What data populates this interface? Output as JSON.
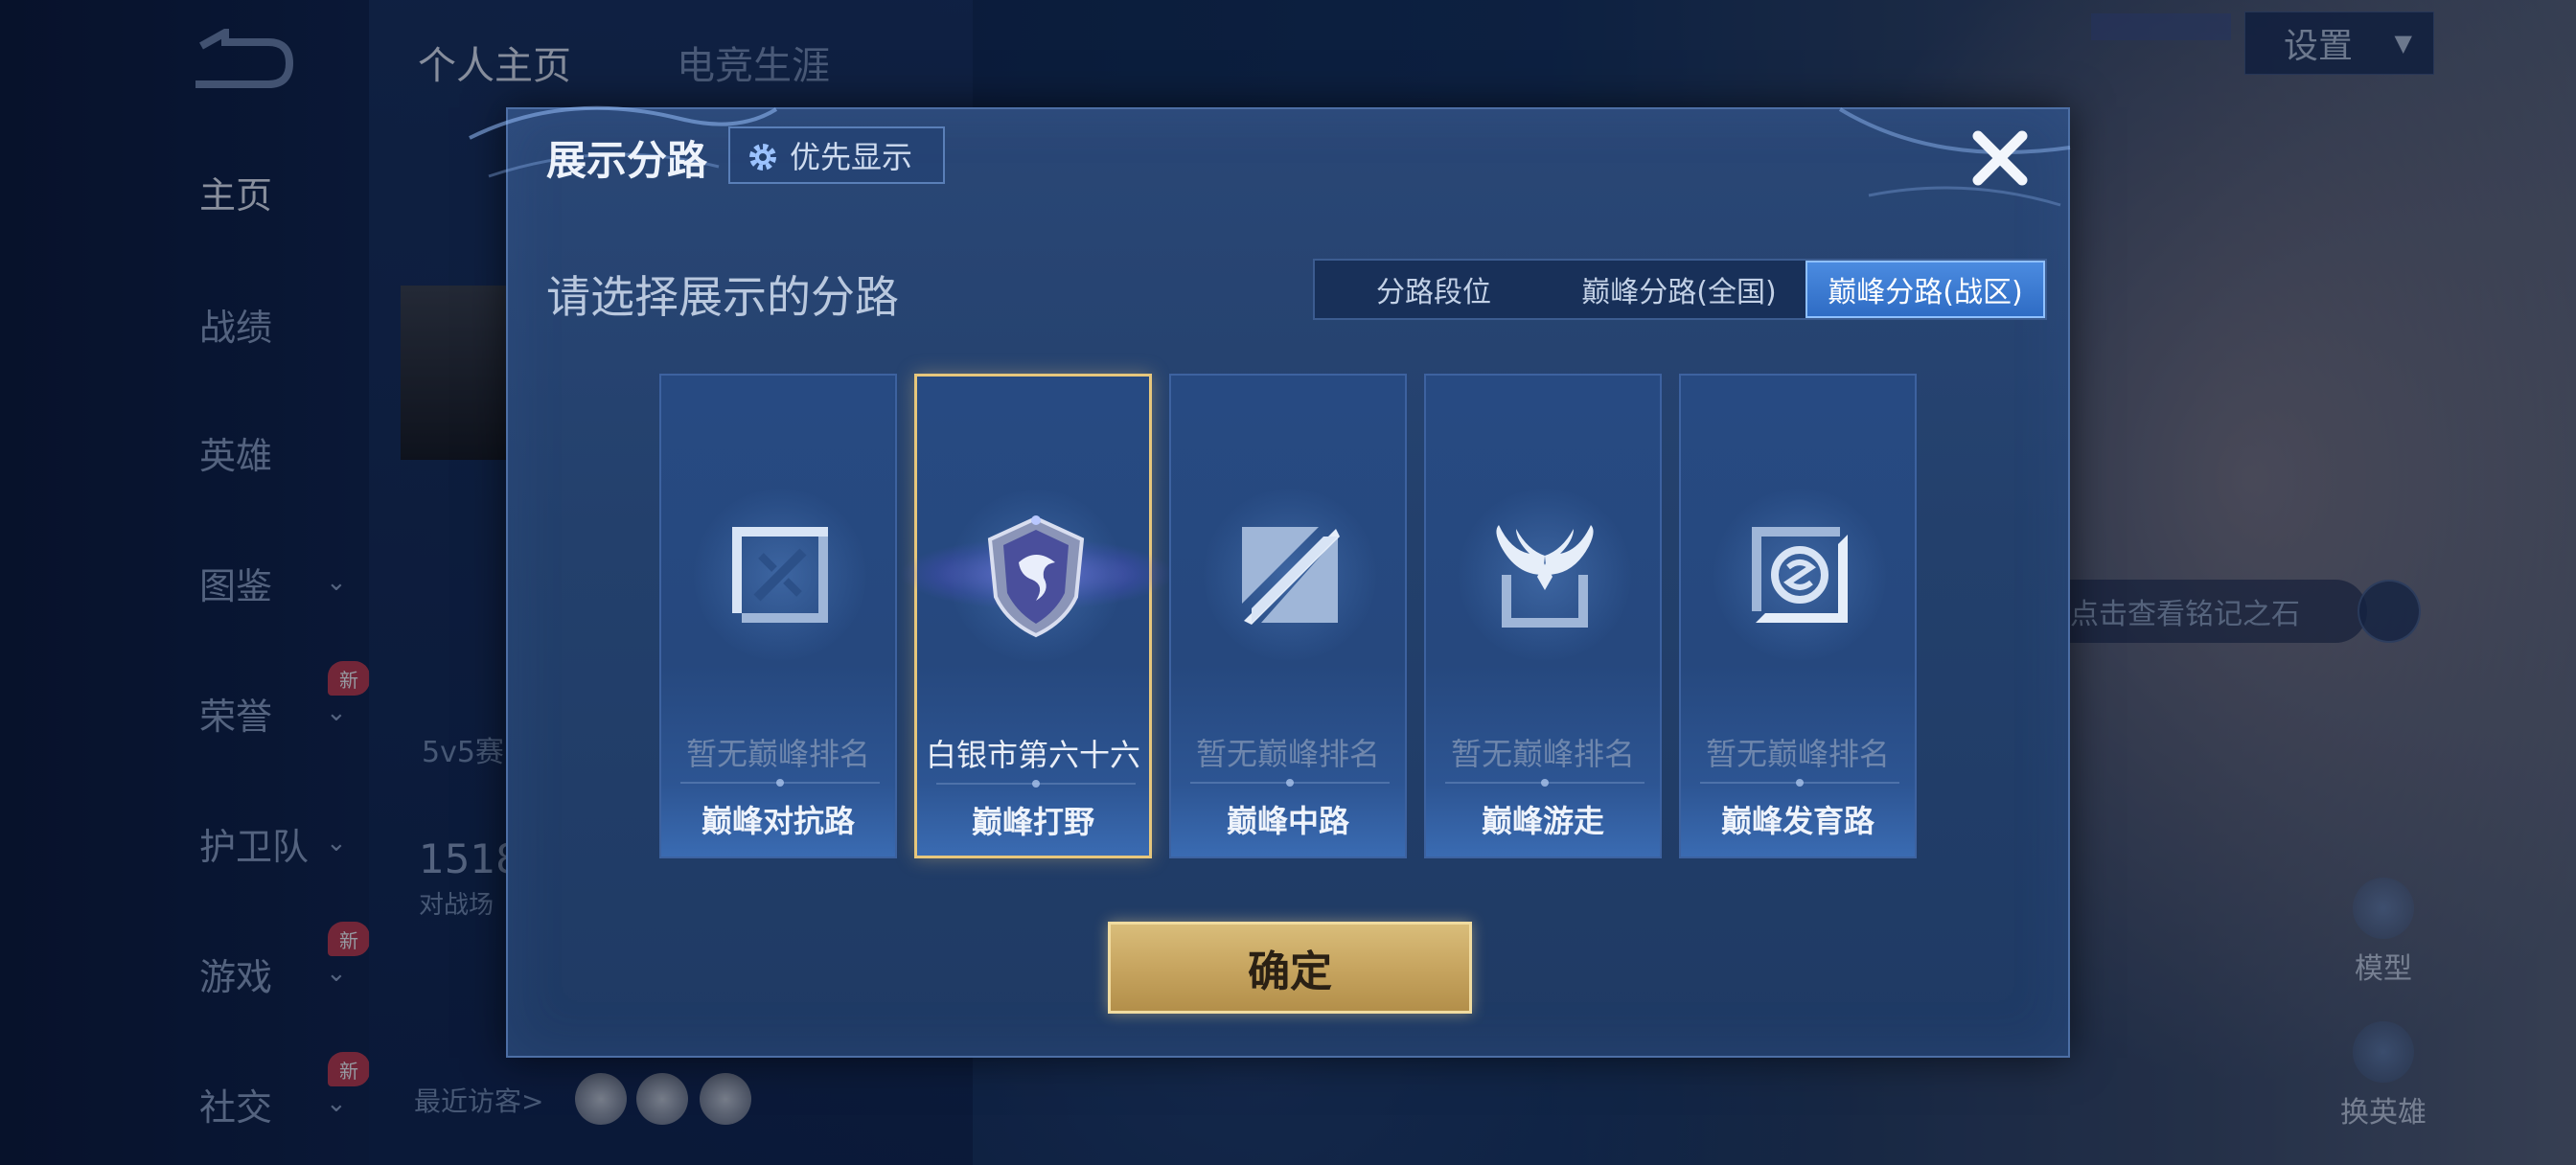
{
  "top_tabs": [
    "个人主页",
    "电竞生涯"
  ],
  "left_nav": [
    {
      "label": "主页",
      "active": true,
      "chevron": false,
      "badge": ""
    },
    {
      "label": "战绩",
      "active": false,
      "chevron": false,
      "badge": ""
    },
    {
      "label": "英雄",
      "active": false,
      "chevron": false,
      "badge": ""
    },
    {
      "label": "图鉴",
      "active": false,
      "chevron": true,
      "badge": ""
    },
    {
      "label": "荣誉",
      "active": false,
      "chevron": true,
      "badge": "新"
    },
    {
      "label": "护卫队",
      "active": false,
      "chevron": true,
      "badge": ""
    },
    {
      "label": "游戏",
      "active": false,
      "chevron": true,
      "badge": "新"
    },
    {
      "label": "社交",
      "active": false,
      "chevron": true,
      "badge": "新"
    }
  ],
  "settings": {
    "label": "设置"
  },
  "background": {
    "mid_text_1": "5v5赛",
    "mid_text_2": "1518",
    "mid_text_3": "对战场",
    "recent_visitors": "最近访客>",
    "rune_hint": "点击查看铭记之石",
    "model_btn": "模型",
    "change_hero_btn": "换英雄"
  },
  "dialog": {
    "title": "展示分路",
    "priority_label": "优先显示",
    "subtitle": "请选择展示的分路",
    "segments": [
      {
        "label": "分路段位",
        "active": false
      },
      {
        "label": "巅峰分路(全国)",
        "active": false
      },
      {
        "label": "巅峰分路(战区)",
        "active": true
      }
    ],
    "lanes": [
      {
        "name": "巅峰对抗路",
        "rank": "暂无巅峰排名",
        "selected": false,
        "icon": "clash-lane-icon"
      },
      {
        "name": "巅峰打野",
        "rank": "白银市第六十六",
        "selected": true,
        "icon": "jungle-emblem-icon"
      },
      {
        "name": "巅峰中路",
        "rank": "暂无巅峰排名",
        "selected": false,
        "icon": "mid-lane-icon"
      },
      {
        "name": "巅峰游走",
        "rank": "暂无巅峰排名",
        "selected": false,
        "icon": "roam-wings-icon"
      },
      {
        "name": "巅峰发育路",
        "rank": "暂无巅峰排名",
        "selected": false,
        "icon": "farm-lane-icon"
      }
    ],
    "confirm_label": "确定"
  },
  "colors": {
    "accent_gold": "#e7c77c",
    "active_blue": "#4b8be0",
    "panel_blue": "#23406c"
  }
}
